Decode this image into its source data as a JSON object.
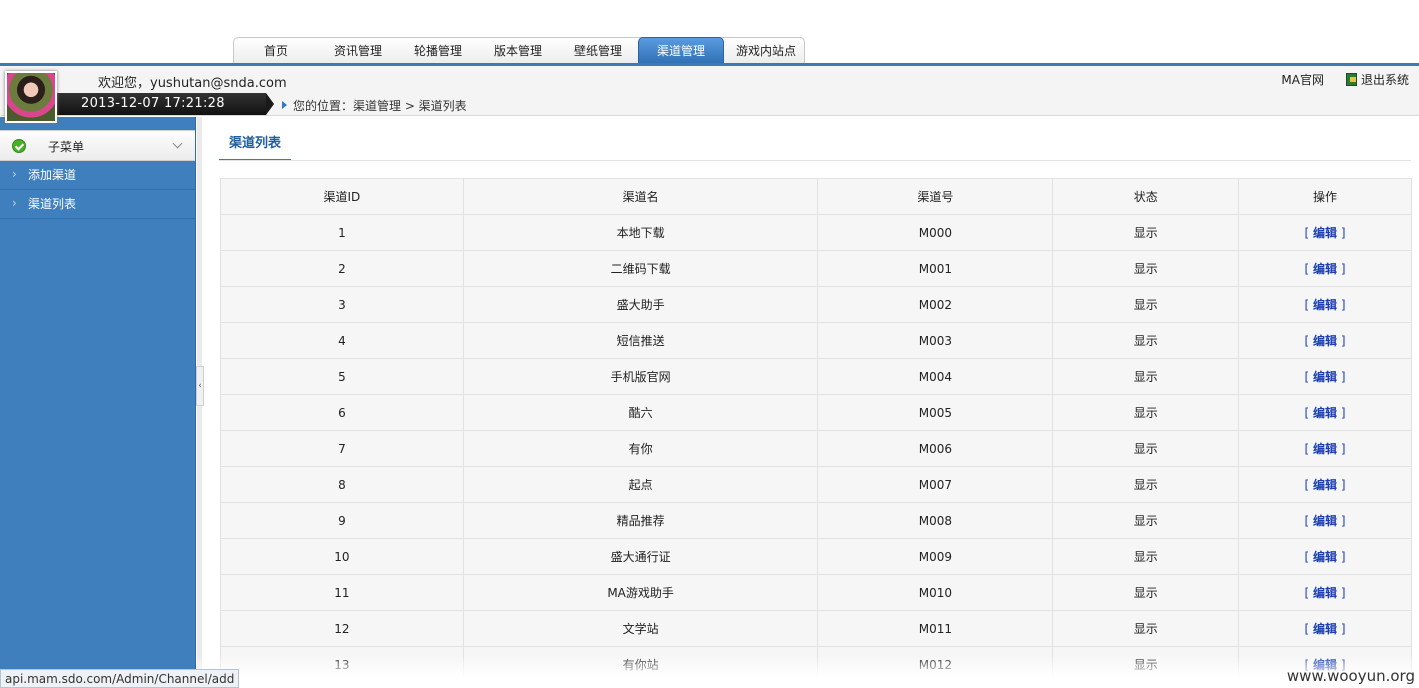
{
  "nav": {
    "tabs": [
      {
        "label": "首页"
      },
      {
        "label": "资讯管理"
      },
      {
        "label": "轮播管理"
      },
      {
        "label": "版本管理"
      },
      {
        "label": "壁纸管理"
      },
      {
        "label": "渠道管理",
        "active": true
      },
      {
        "label": "游戏内站点"
      }
    ]
  },
  "header": {
    "welcome": "欢迎您，yushutan@snda.com",
    "datetime": "2013-12-07 17:21:28",
    "breadcrumb": "您的位置：渠道管理 > 渠道列表",
    "link_ma": "MA官网",
    "link_logout": "退出系统"
  },
  "sidebar": {
    "title": "子菜单",
    "items": [
      {
        "label": "添加渠道"
      },
      {
        "label": "渠道列表"
      }
    ]
  },
  "main": {
    "tab_label": "渠道列表",
    "columns": [
      "渠道ID",
      "渠道名",
      "渠道号",
      "状态",
      "操作"
    ],
    "rows": [
      {
        "id": "1",
        "name": "本地下载",
        "code": "M000",
        "status": "显示"
      },
      {
        "id": "2",
        "name": "二维码下载",
        "code": "M001",
        "status": "显示"
      },
      {
        "id": "3",
        "name": "盛大助手",
        "code": "M002",
        "status": "显示"
      },
      {
        "id": "4",
        "name": "短信推送",
        "code": "M003",
        "status": "显示"
      },
      {
        "id": "5",
        "name": "手机版官网",
        "code": "M004",
        "status": "显示"
      },
      {
        "id": "6",
        "name": "酷六",
        "code": "M005",
        "status": "显示"
      },
      {
        "id": "7",
        "name": "有你",
        "code": "M006",
        "status": "显示"
      },
      {
        "id": "8",
        "name": "起点",
        "code": "M007",
        "status": "显示"
      },
      {
        "id": "9",
        "name": "精品推荐",
        "code": "M008",
        "status": "显示"
      },
      {
        "id": "10",
        "name": "盛大通行证",
        "code": "M009",
        "status": "显示"
      },
      {
        "id": "11",
        "name": "MA游戏助手",
        "code": "M010",
        "status": "显示"
      },
      {
        "id": "12",
        "name": "文学站",
        "code": "M011",
        "status": "显示"
      },
      {
        "id": "13",
        "name": "有你站",
        "code": "M012",
        "status": "显示"
      }
    ],
    "edit_label": "编辑"
  },
  "statusbar": "api.mam.sdo.com/Admin/Channel/add",
  "watermark": "www.wooyun.org"
}
